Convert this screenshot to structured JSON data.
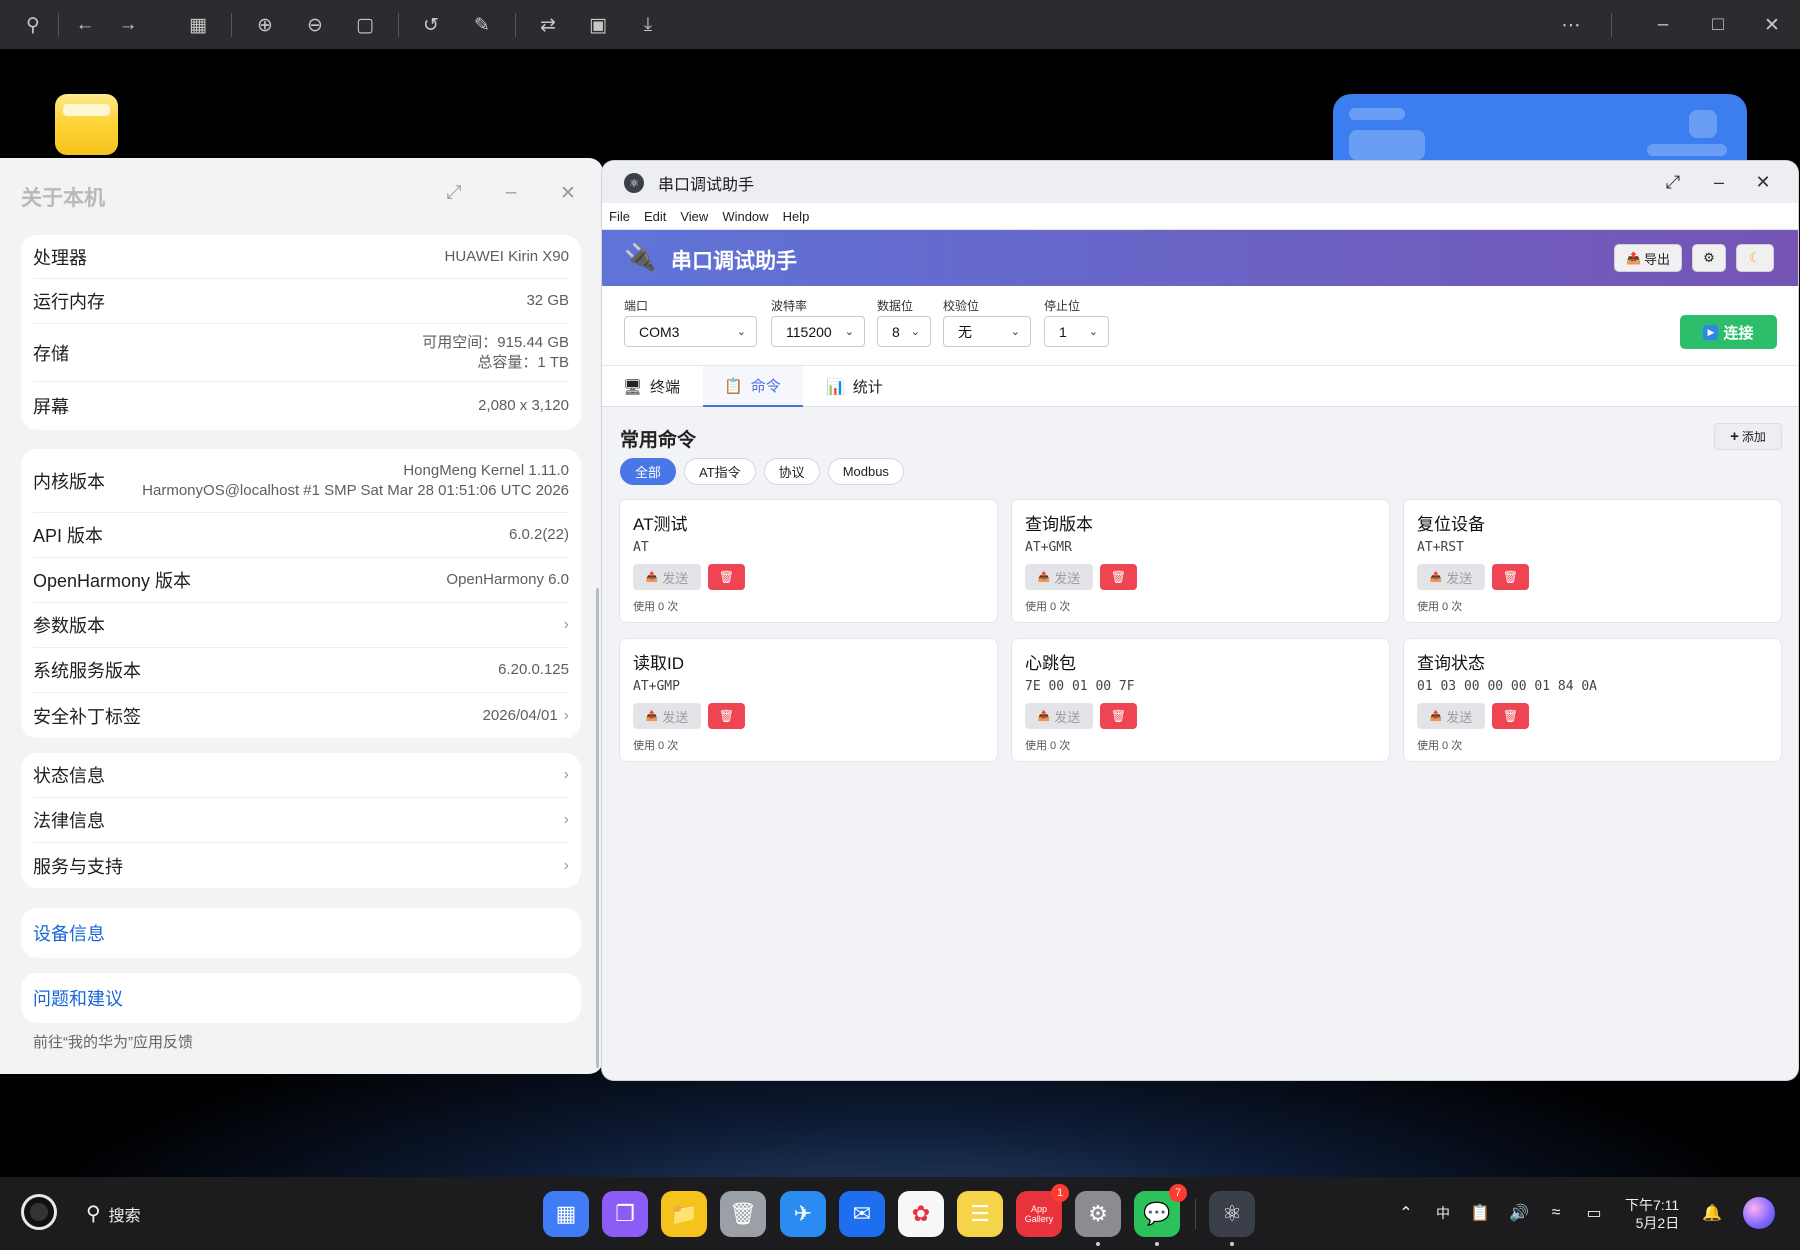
{
  "viewer_toolbar": {
    "icons": [
      "pin-icon",
      "back-arrow-icon",
      "forward-arrow-icon",
      "grid-icon",
      "zoom-in-icon",
      "zoom-out-icon",
      "actual-size-icon",
      "rotate-icon",
      "edit-icon",
      "convert-icon",
      "crop-icon",
      "download-icon",
      "more-icon",
      "minimize-icon",
      "maximize-icon",
      "close-icon"
    ]
  },
  "about_window": {
    "title": "关于本机",
    "hardware": [
      {
        "label": "处理器",
        "value": "HUAWEI Kirin X90"
      },
      {
        "label": "运行内存",
        "value": "32 GB"
      },
      {
        "label": "存储",
        "value": "可用空间：915.44 GB",
        "value2": "总容量：1 TB"
      },
      {
        "label": "屏幕",
        "value": "2,080 x 3,120"
      }
    ],
    "software": {
      "kernel": {
        "label": "内核版本",
        "value": "HongMeng Kernel 1.11.0",
        "value2": "HarmonyOS@localhost #1 SMP Sat Mar 28 01:51:06 UTC 2026"
      },
      "api": {
        "label": "API 版本",
        "value": "6.0.2(22)"
      },
      "openharmony": {
        "label": "OpenHarmony 版本",
        "value": "OpenHarmony 6.0"
      },
      "params": {
        "label": "参数版本"
      },
      "sysservice": {
        "label": "系统服务版本",
        "value": "6.20.0.125"
      },
      "patch": {
        "label": "安全补丁标签",
        "value": "2026/04/01"
      }
    },
    "info_links": [
      "状态信息",
      "法律信息",
      "服务与支持"
    ],
    "device_info": "设备信息",
    "feedback": "问题和建议",
    "feedback_note": "前往“我的华为”应用反馈"
  },
  "serial_window": {
    "title": "串口调试助手",
    "menu": [
      "File",
      "Edit",
      "View",
      "Window",
      "Help"
    ],
    "header": {
      "title": "串口调试助手",
      "export_label": "导出"
    },
    "config": {
      "port": {
        "label": "端口",
        "value": "COM3"
      },
      "baud": {
        "label": "波特率",
        "value": "115200"
      },
      "databits": {
        "label": "数据位",
        "value": "8"
      },
      "parity": {
        "label": "校验位",
        "value": "无"
      },
      "stopbits": {
        "label": "停止位",
        "value": "1"
      },
      "connect_label": "连接"
    },
    "tabs": [
      {
        "label": "终端",
        "active": false
      },
      {
        "label": "命令",
        "active": true
      },
      {
        "label": "统计",
        "active": false
      }
    ],
    "commands_section": {
      "title": "常用命令",
      "add_label": "添加",
      "filters": [
        "全部",
        "AT指令",
        "协议",
        "Modbus"
      ],
      "active_filter": "全部",
      "send_label": "发送",
      "items": [
        {
          "name": "AT测试",
          "code": "AT",
          "usage": "使用 0 次"
        },
        {
          "name": "查询版本",
          "code": "AT+GMR",
          "usage": "使用 0 次"
        },
        {
          "name": "复位设备",
          "code": "AT+RST",
          "usage": "使用 0 次"
        },
        {
          "name": "读取ID",
          "code": "AT+GMP",
          "usage": "使用 0 次"
        },
        {
          "name": "心跳包",
          "code": "7E 00 01 00 7F",
          "usage": "使用 0 次"
        },
        {
          "name": "查询状态",
          "code": "01 03 00 00 00 01 84 0A",
          "usage": "使用 0 次"
        }
      ]
    }
  },
  "taskbar": {
    "search_label": "搜索",
    "apps": [
      {
        "name": "app-center-icon",
        "color": "#3f7cf6",
        "badge": ""
      },
      {
        "name": "multitask-icon",
        "color": "#8b5cf6",
        "badge": ""
      },
      {
        "name": "files-icon",
        "color": "#f6c21c",
        "badge": ""
      },
      {
        "name": "trash-icon",
        "color": "#9aa0a6",
        "badge": ""
      },
      {
        "name": "browser-icon",
        "color": "#2a8cf0",
        "badge": ""
      },
      {
        "name": "mail-icon",
        "color": "#1e6ff0",
        "badge": ""
      },
      {
        "name": "photos-icon",
        "color": "#f7f7f7",
        "badge": ""
      },
      {
        "name": "notes-icon",
        "color": "#f6d44a",
        "badge": ""
      },
      {
        "name": "app-gallery-icon",
        "color": "#e8323c",
        "badge": "1",
        "label": "App Gallery"
      },
      {
        "name": "settings-icon",
        "color": "#8c8c90",
        "badge": ""
      },
      {
        "name": "wechat-icon",
        "color": "#2dc15b",
        "badge": "7"
      }
    ],
    "pinned_app": "electron-app-icon",
    "tray": {
      "ime": "中"
    },
    "clock": {
      "time": "下午7:11",
      "date": "5月2日"
    }
  }
}
